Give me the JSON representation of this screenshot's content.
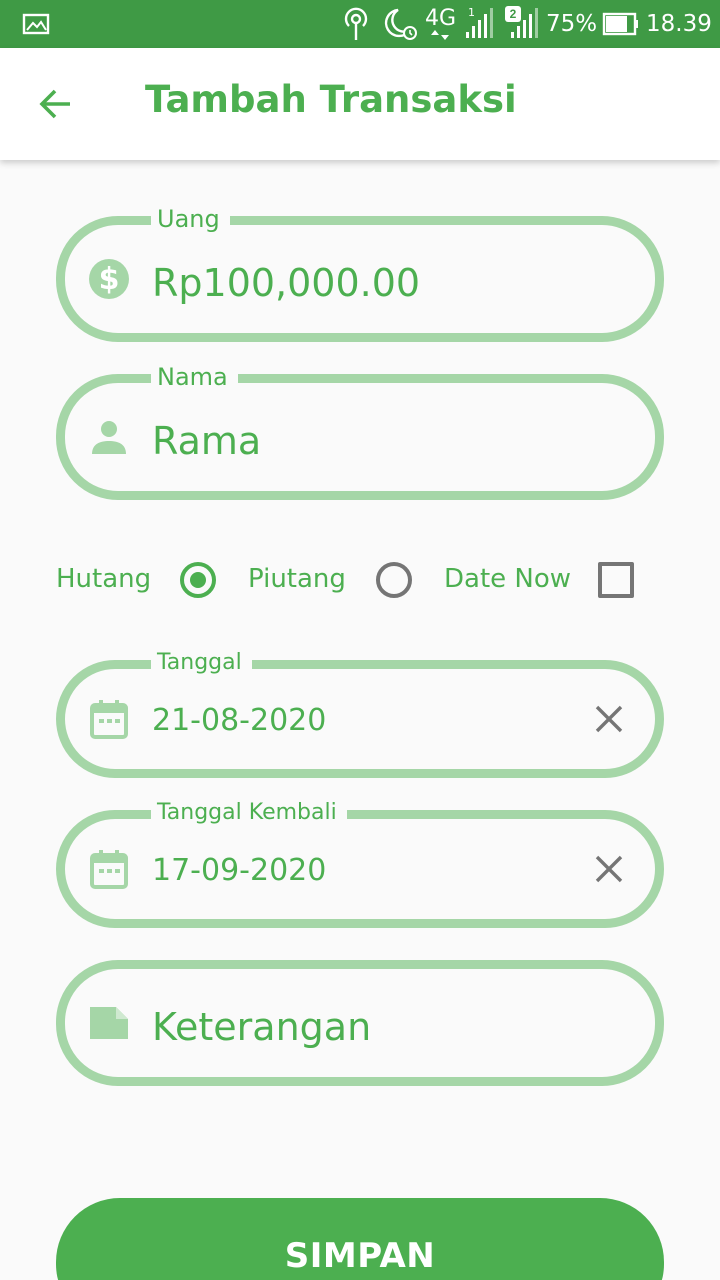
{
  "statusbar": {
    "network": "4G",
    "sim1": "1",
    "sim2": "2",
    "battery": "75%",
    "time": "18.39",
    "icons": [
      "image-icon",
      "hotspot-icon",
      "moon-alarm-icon",
      "signal-icon",
      "signal-icon",
      "battery-icon"
    ]
  },
  "appbar": {
    "title": "Tambah Transaksi",
    "back_icon": "arrow-left-icon"
  },
  "form": {
    "uang": {
      "label": "Uang",
      "value": "Rp100,000.00",
      "icon": "dollar-icon"
    },
    "nama": {
      "label": "Nama",
      "value": "Rama",
      "icon": "person-icon"
    },
    "options": {
      "hutang": {
        "label": "Hutang",
        "selected": true
      },
      "piutang": {
        "label": "Piutang",
        "selected": false
      },
      "date_now": {
        "label": "Date Now",
        "checked": false
      }
    },
    "tanggal": {
      "label": "Tanggal",
      "value": "21-08-2020",
      "icon": "calendar-icon"
    },
    "tanggal_kembali": {
      "label": "Tanggal Kembali",
      "value": "17-09-2020",
      "icon": "calendar-icon"
    },
    "keterangan": {
      "placeholder": "Keterangan",
      "icon": "note-icon"
    }
  },
  "save_button": {
    "label": "SIMPAN"
  },
  "colors": {
    "primary": "#4caf50",
    "status_bar": "#3f9a45",
    "outline": "#a5d6a7",
    "grey": "#757575"
  }
}
